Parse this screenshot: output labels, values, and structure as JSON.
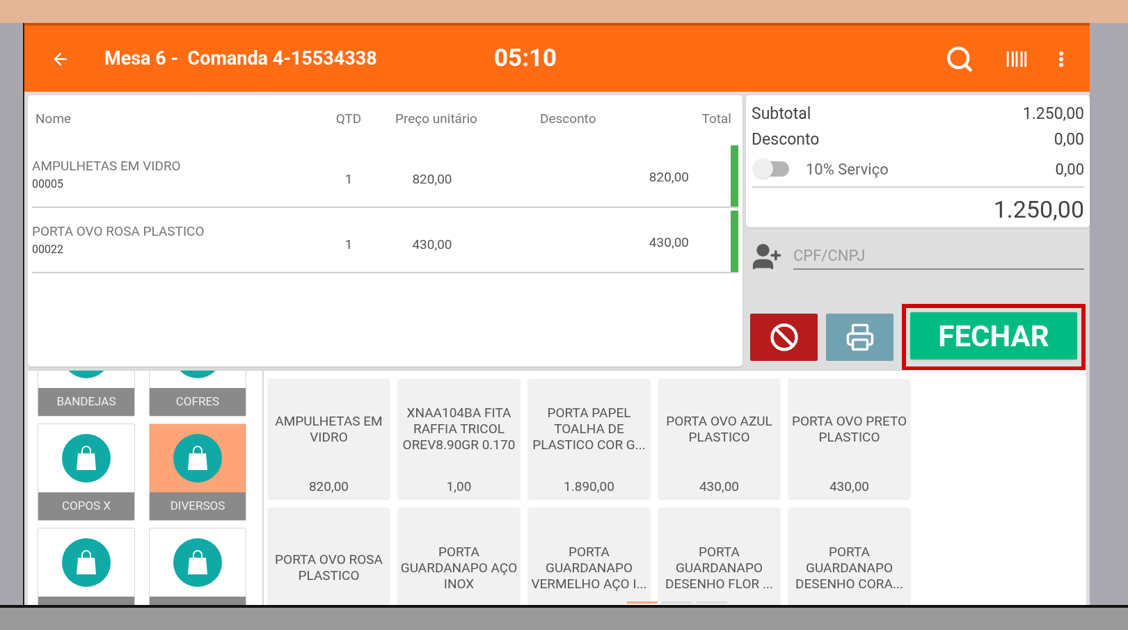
{
  "header": {
    "title": "Mesa 6 -  Comanda 4-15534338",
    "time": "05:10"
  },
  "table": {
    "columns": [
      "Nome",
      "QTD",
      "Preço unitário",
      "Desconto",
      "Total"
    ],
    "rows": [
      {
        "name": "AMPULHETAS EM VIDRO",
        "code": "00005",
        "qtd": "1",
        "price": "820,00",
        "total": "820,00"
      },
      {
        "name": "PORTA OVO ROSA PLASTICO",
        "code": "00022",
        "qtd": "1",
        "price": "430,00",
        "total": "430,00"
      }
    ]
  },
  "summary": {
    "subtotal_label": "Subtotal",
    "subtotal": "1.250,00",
    "discount_label": "Desconto",
    "discount": "0,00",
    "service_label": "10% Serviço",
    "service_on": false,
    "service": "0,00",
    "total": "1.250,00"
  },
  "customer": {
    "placeholder": "CPF/CNPJ"
  },
  "close_button": "FECHAR",
  "categories": [
    {
      "name": "BANDEJAS",
      "selected": false
    },
    {
      "name": "COFRES",
      "selected": false
    },
    {
      "name": "COPOS X",
      "selected": false
    },
    {
      "name": "DIVERSOS",
      "selected": true
    },
    {
      "selected": false
    },
    {
      "selected": false
    }
  ],
  "products": [
    {
      "name": "AMPULHETAS EM VIDRO",
      "price": "820,00"
    },
    {
      "name": "XNAA104BA FITA RAFFIA TRICOL OREV8.90GR 0.170",
      "price": "1,00"
    },
    {
      "name": "PORTA PAPEL TOALHA DE PLASTICO COR G...",
      "price": "1.890,00"
    },
    {
      "name": "PORTA OVO AZUL PLASTICO",
      "price": "430,00"
    },
    {
      "name": "PORTA OVO PRETO PLASTICO",
      "price": "430,00"
    },
    {
      "name": "PORTA OVO ROSA PLASTICO"
    },
    {
      "name": "PORTA GUARDANAPO AÇO INOX"
    },
    {
      "name": "PORTA GUARDANAPO VERMELHO AÇO I..."
    },
    {
      "name": "PORTA GUARDANAPO DESENHO FLOR ..."
    },
    {
      "name": "PORTA GUARDANAPO DESENHO CORA..."
    }
  ],
  "pages": [
    {
      "selected": true
    },
    {
      "selected": false
    },
    {
      "selected": false
    }
  ]
}
